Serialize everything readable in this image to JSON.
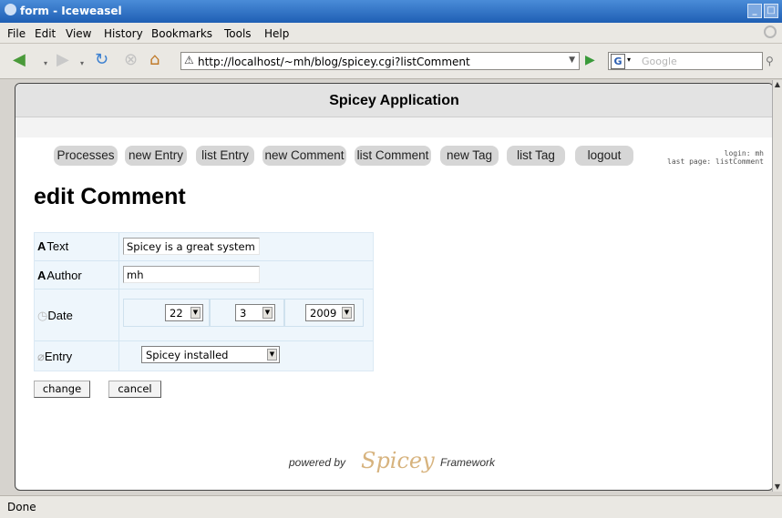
{
  "window": {
    "title": "form - Iceweasel"
  },
  "menu": [
    "File",
    "Edit",
    "View",
    "History",
    "Bookmarks",
    "Tools",
    "Help"
  ],
  "nav": {
    "url": "http://localhost/~mh/blog/spicey.cgi?listComment",
    "search_placeholder": "Google",
    "search_engine": "G"
  },
  "app": {
    "header": "Spicey Application"
  },
  "tabs": [
    "Processes",
    "new Entry",
    "list Entry",
    "new Comment",
    "list Comment",
    "new Tag",
    "list Tag",
    "logout"
  ],
  "login": {
    "line1": "login: mh",
    "line2": "last page: listComment"
  },
  "page_title": "edit Comment",
  "form": {
    "text_label": "Text",
    "text_value": "Spicey is a great system",
    "author_label": "Author",
    "author_value": "mh",
    "date_label": "Date",
    "date_day": "22",
    "date_month": "3",
    "date_year": "2009",
    "entry_label": "Entry",
    "entry_value": "Spicey installed",
    "icon_text": "A",
    "icon_author": "A"
  },
  "buttons": {
    "change": "change",
    "cancel": "cancel"
  },
  "footer": {
    "powered_by": "powered by",
    "logo": "Spicey",
    "framework": "Framework"
  },
  "status": "Done"
}
